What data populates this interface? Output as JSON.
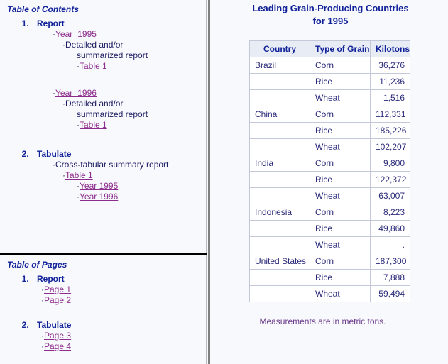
{
  "left": {
    "toc": {
      "title": "Table of Contents",
      "items": [
        {
          "label": "Report",
          "groups": [
            {
              "link": "Year=1995",
              "desc_line1": "Detailed and/or",
              "desc_line2": "summarized report",
              "table_link": "Table 1"
            },
            {
              "link": "Year=1996",
              "desc_line1": "Detailed and/or",
              "desc_line2": "summarized report",
              "table_link": "Table 1"
            }
          ]
        },
        {
          "label": "Tabulate",
          "desc": "Cross-tabular summary report",
          "table_link": "Table 1",
          "year_links": [
            "Year 1995",
            "Year 1996"
          ]
        }
      ]
    },
    "top": {
      "title": "Table of Pages",
      "items": [
        {
          "label": "Report",
          "pages": [
            "Page 1",
            "Page 2"
          ]
        },
        {
          "label": "Tabulate",
          "pages": [
            "Page 3",
            "Page 4"
          ]
        }
      ]
    }
  },
  "right": {
    "title_line1": "Leading Grain-Producing Countries",
    "title_line2": "for 1995",
    "footnote": "Measurements are in metric tons.",
    "table": {
      "headers": [
        "Country",
        "Type of Grain",
        "Kilotons"
      ],
      "rows": [
        {
          "country": "Brazil",
          "grain": "Corn",
          "kilotons": "36,276"
        },
        {
          "country": "",
          "grain": "Rice",
          "kilotons": "11,236"
        },
        {
          "country": "",
          "grain": "Wheat",
          "kilotons": "1,516"
        },
        {
          "country": "China",
          "grain": "Corn",
          "kilotons": "112,331"
        },
        {
          "country": "",
          "grain": "Rice",
          "kilotons": "185,226"
        },
        {
          "country": "",
          "grain": "Wheat",
          "kilotons": "102,207"
        },
        {
          "country": "India",
          "grain": "Corn",
          "kilotons": "9,800"
        },
        {
          "country": "",
          "grain": "Rice",
          "kilotons": "122,372"
        },
        {
          "country": "",
          "grain": "Wheat",
          "kilotons": "63,007"
        },
        {
          "country": "Indonesia",
          "grain": "Corn",
          "kilotons": "8,223"
        },
        {
          "country": "",
          "grain": "Rice",
          "kilotons": "49,860"
        },
        {
          "country": "",
          "grain": "Wheat",
          "kilotons": "."
        },
        {
          "country": "United States",
          "grain": "Corn",
          "kilotons": "187,300"
        },
        {
          "country": "",
          "grain": "Rice",
          "kilotons": "7,888"
        },
        {
          "country": "",
          "grain": "Wheat",
          "kilotons": "59,494"
        }
      ]
    }
  },
  "colors": {
    "heading": "#112299",
    "link": "#8c2c8c",
    "table_header_bg": "#e8ecf5",
    "page_bg": "#f8f9fd"
  }
}
